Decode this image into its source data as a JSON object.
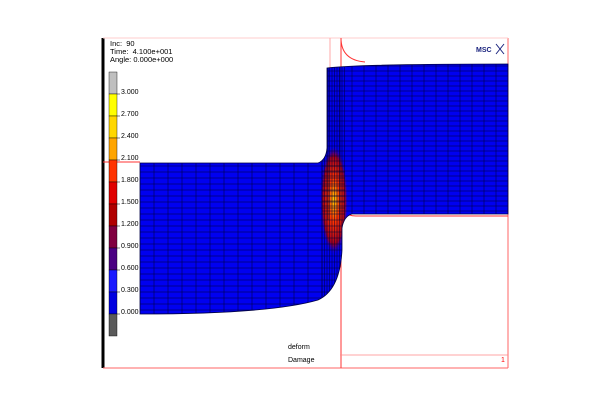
{
  "header": {
    "increment": "Inc:  90",
    "time": "Time:  4.100e+001",
    "angle": "Angle: 0.000e+000"
  },
  "logo_text": "MSC",
  "legend": {
    "ticks": [
      "3.000",
      "2.700",
      "2.400",
      "2.100",
      "1.800",
      "1.500",
      "1.200",
      "0.900",
      "0.600",
      "0.300",
      "0.000"
    ],
    "colors": [
      "#bfbfbf",
      "#ffff00",
      "#ffd700",
      "#ffa500",
      "#ff3300",
      "#e00000",
      "#b00000",
      "#800040",
      "#4b0082",
      "#1a1aff",
      "#0000e0",
      "#5a5a5a"
    ]
  },
  "footer": {
    "model_name": "deform",
    "variable_name": "Damage",
    "window_number": "1"
  },
  "colors": {
    "mesh_fill": "#0000f0",
    "mesh_lines": "#000033",
    "frame": "#ff0000",
    "hot_zone": "#ff4400"
  }
}
